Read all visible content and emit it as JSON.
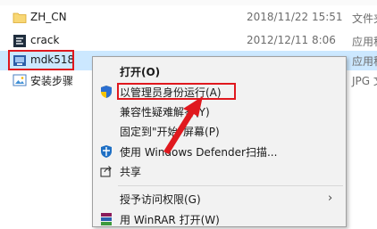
{
  "files": [
    {
      "name": "ZH_CN",
      "date": "2018/11/22 15:51",
      "type": "文件夹",
      "icon": "folder-icon"
    },
    {
      "name": "crack",
      "date": "2012/12/11 8:06",
      "type": "应用程",
      "icon": "app-icon"
    },
    {
      "name": "mdk518",
      "date": "",
      "type": "应用程",
      "icon": "installer-icon"
    },
    {
      "name": "安装步骤",
      "date": "",
      "type": "JPG 文",
      "icon": "image-icon"
    }
  ],
  "context_menu": {
    "items": [
      {
        "label": "打开(O)",
        "bold": true
      },
      {
        "label": "以管理员身份运行(A)",
        "icon": "shield-icon"
      },
      {
        "label": "兼容性疑难解答(Y)"
      },
      {
        "label": "固定到\"开始\"屏幕(P)"
      },
      {
        "label": "使用 Windows Defender扫描...",
        "icon": "defender-icon"
      },
      {
        "label": "共享",
        "icon": "share-icon"
      },
      {
        "label": "授予访问权限(G)",
        "submenu": true
      },
      {
        "label": "用 WinRAR 打开(W)",
        "icon": "winrar-icon"
      }
    ]
  },
  "colors": {
    "annotation_red": "#e0181e",
    "selection_bg": "#cce8ff"
  }
}
